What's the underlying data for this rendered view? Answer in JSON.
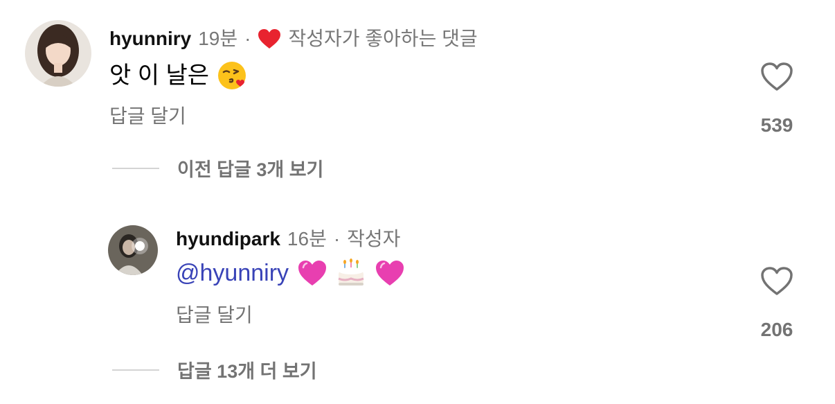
{
  "comments": [
    {
      "username": "hyunniry",
      "time": "19분",
      "separator": "·",
      "liked_by_author_text": "작성자가 좋아하는 댓글",
      "text": "앗 이 날은",
      "emoji_icon": "face-blowing-kiss-icon",
      "reply_label": "답글 달기",
      "like_count": "539",
      "heart_color": "#e8232f"
    },
    {
      "username": "hyundipark",
      "time": "16분",
      "separator": "·",
      "author_tag": "작성자",
      "mention": "@hyunniry",
      "emoji_icons": [
        "pink-heart-icon",
        "birthday-cake-icon",
        "pink-heart-icon"
      ],
      "reply_label": "답글 달기",
      "like_count": "206",
      "mention_color": "#3943b7"
    }
  ],
  "threads": {
    "previous_replies": "이전 답글 3개 보기",
    "more_replies": "답글 13개 더 보기"
  }
}
